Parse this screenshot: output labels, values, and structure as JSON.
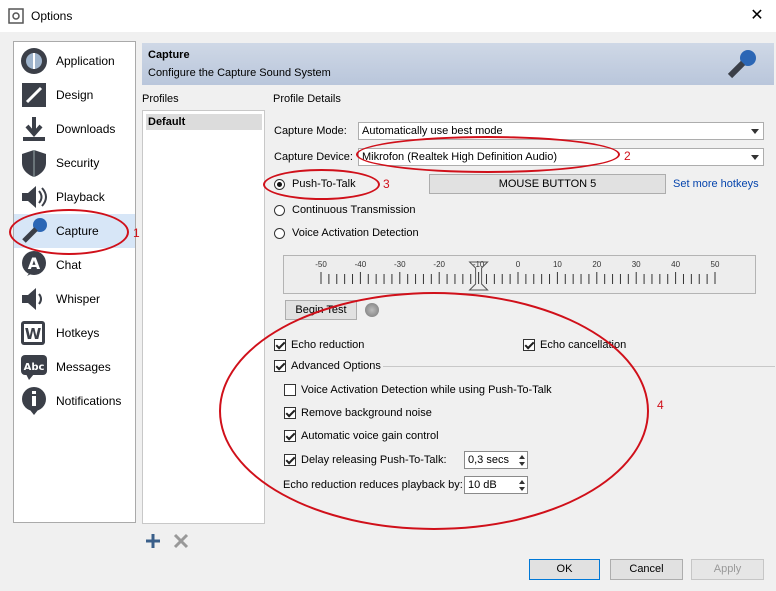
{
  "window": {
    "title": "Options",
    "close_glyph": "✕"
  },
  "sidebar": {
    "items": [
      {
        "label": "Application",
        "icon": "application-icon"
      },
      {
        "label": "Design",
        "icon": "design-icon"
      },
      {
        "label": "Downloads",
        "icon": "downloads-icon"
      },
      {
        "label": "Security",
        "icon": "security-icon"
      },
      {
        "label": "Playback",
        "icon": "playback-icon"
      },
      {
        "label": "Capture",
        "icon": "capture-icon",
        "selected": true
      },
      {
        "label": "Chat",
        "icon": "chat-icon"
      },
      {
        "label": "Whisper",
        "icon": "whisper-icon"
      },
      {
        "label": "Hotkeys",
        "icon": "hotkeys-icon"
      },
      {
        "label": "Messages",
        "icon": "messages-icon"
      },
      {
        "label": "Notifications",
        "icon": "notifications-icon"
      }
    ]
  },
  "header": {
    "title": "Capture",
    "subtitle": "Configure the Capture Sound System",
    "icon": "microphone-icon"
  },
  "profiles": {
    "label": "Profiles",
    "items": [
      "Default"
    ]
  },
  "details": {
    "label": "Profile Details",
    "capture_mode": {
      "label": "Capture Mode:",
      "value": "Automatically use best mode"
    },
    "capture_device": {
      "label": "Capture Device:",
      "value": "Mikrofon (Realtek High Definition Audio)"
    },
    "push_to_talk": {
      "label": "Push-To-Talk",
      "selected": true
    },
    "hotkey_button": "MOUSE BUTTON 5",
    "more_hotkeys": "Set more hotkeys",
    "continuous": {
      "label": "Continuous Transmission",
      "selected": false
    },
    "voice_activation": {
      "label": "Voice Activation Detection",
      "selected": false
    },
    "meter": {
      "ticks": [
        "-50",
        "-40",
        "-30",
        "-20",
        "-10",
        "0",
        "10",
        "20",
        "30",
        "40",
        "50"
      ],
      "marker_value": -10
    },
    "begin_test": "Begin Test",
    "echo_reduction": {
      "label": "Echo reduction",
      "checked": true
    },
    "echo_cancellation": {
      "label": "Echo cancellation",
      "checked": true
    },
    "advanced": {
      "label": "Advanced Options",
      "checked": true
    },
    "vad_ptt": {
      "label": "Voice Activation Detection while using Push-To-Talk",
      "checked": false
    },
    "remove_noise": {
      "label": "Remove background noise",
      "checked": true
    },
    "auto_gain": {
      "label": "Automatic voice gain control",
      "checked": true
    },
    "delay_release": {
      "label": "Delay releasing Push-To-Talk:",
      "checked": true,
      "value": "0,3 secs"
    },
    "echo_playback": {
      "label": "Echo reduction reduces playback by:",
      "value": "10 dB"
    }
  },
  "buttons": {
    "ok": "OK",
    "cancel": "Cancel",
    "apply": "Apply"
  },
  "annotations": {
    "n1": "1",
    "n2": "2",
    "n3": "3",
    "n4": "4",
    "color": "#d0101a"
  }
}
